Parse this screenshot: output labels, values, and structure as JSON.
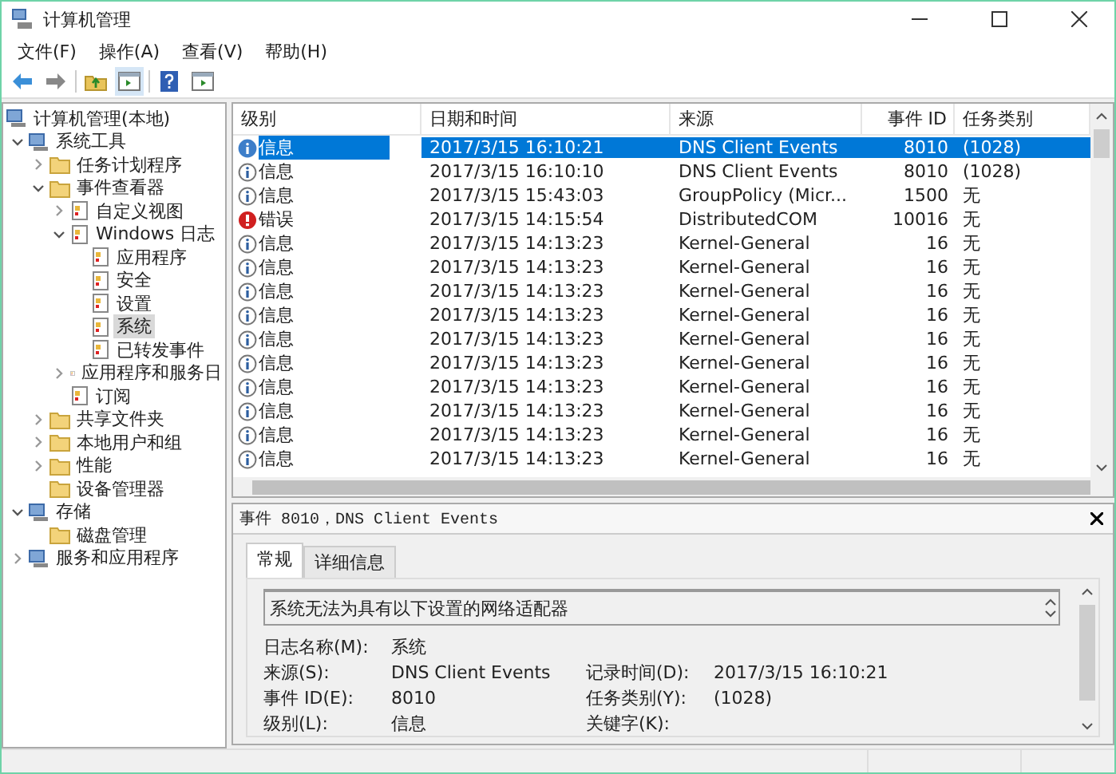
{
  "window": {
    "title": "计算机管理"
  },
  "menu": [
    "文件(F)",
    "操作(A)",
    "查看(V)",
    "帮助(H)"
  ],
  "tree": [
    {
      "label": "计算机管理(本地)",
      "selected": false,
      "children": [
        {
          "label": "系统工具",
          "selected": false,
          "expanded": true,
          "children": [
            {
              "label": "任务计划程序",
              "selected": false,
              "expanded": false
            },
            {
              "label": "事件查看器",
              "selected": false,
              "expanded": true,
              "children": [
                {
                  "label": "自定义视图",
                  "selected": false,
                  "expanded": false
                },
                {
                  "label": "Windows 日志",
                  "selected": false,
                  "expanded": true,
                  "children": [
                    {
                      "label": "应用程序",
                      "selected": false
                    },
                    {
                      "label": "安全",
                      "selected": false
                    },
                    {
                      "label": "设置",
                      "selected": false
                    },
                    {
                      "label": "系统",
                      "selected": true
                    },
                    {
                      "label": "已转发事件",
                      "selected": false
                    }
                  ]
                },
                {
                  "label": "应用程序和服务日",
                  "selected": false,
                  "expanded": false
                },
                {
                  "label": "订阅",
                  "selected": false
                }
              ]
            },
            {
              "label": "共享文件夹",
              "selected": false,
              "expanded": false
            },
            {
              "label": "本地用户和组",
              "selected": false,
              "expanded": false
            },
            {
              "label": "性能",
              "selected": false,
              "expanded": false
            },
            {
              "label": "设备管理器",
              "selected": false
            }
          ]
        },
        {
          "label": "存储",
          "selected": false,
          "expanded": true,
          "children": [
            {
              "label": "磁盘管理",
              "selected": false
            }
          ]
        },
        {
          "label": "服务和应用程序",
          "selected": false,
          "expanded": false
        }
      ]
    }
  ],
  "table": {
    "columns": [
      "级别",
      "日期和时间",
      "来源",
      "事件 ID",
      "任务类别"
    ],
    "rows": [
      {
        "kind": "info",
        "selected": true,
        "cells": [
          "信息",
          "2017/3/15 16:10:21",
          "DNS Client Events",
          "8010",
          "(1028)"
        ]
      },
      {
        "kind": "info",
        "selected": false,
        "cells": [
          "信息",
          "2017/3/15 16:10:10",
          "DNS Client Events",
          "8010",
          "(1028)"
        ]
      },
      {
        "kind": "info",
        "selected": false,
        "cells": [
          "信息",
          "2017/3/15 15:43:03",
          "GroupPolicy (Micr...",
          "1500",
          "无"
        ]
      },
      {
        "kind": "error",
        "selected": false,
        "cells": [
          "错误",
          "2017/3/15 14:15:54",
          "DistributedCOM",
          "10016",
          "无"
        ]
      },
      {
        "kind": "info",
        "selected": false,
        "cells": [
          "信息",
          "2017/3/15 14:13:23",
          "Kernel-General",
          "16",
          "无"
        ]
      },
      {
        "kind": "info",
        "selected": false,
        "cells": [
          "信息",
          "2017/3/15 14:13:23",
          "Kernel-General",
          "16",
          "无"
        ]
      },
      {
        "kind": "info",
        "selected": false,
        "cells": [
          "信息",
          "2017/3/15 14:13:23",
          "Kernel-General",
          "16",
          "无"
        ]
      },
      {
        "kind": "info",
        "selected": false,
        "cells": [
          "信息",
          "2017/3/15 14:13:23",
          "Kernel-General",
          "16",
          "无"
        ]
      },
      {
        "kind": "info",
        "selected": false,
        "cells": [
          "信息",
          "2017/3/15 14:13:23",
          "Kernel-General",
          "16",
          "无"
        ]
      },
      {
        "kind": "info",
        "selected": false,
        "cells": [
          "信息",
          "2017/3/15 14:13:23",
          "Kernel-General",
          "16",
          "无"
        ]
      },
      {
        "kind": "info",
        "selected": false,
        "cells": [
          "信息",
          "2017/3/15 14:13:23",
          "Kernel-General",
          "16",
          "无"
        ]
      },
      {
        "kind": "info",
        "selected": false,
        "cells": [
          "信息",
          "2017/3/15 14:13:23",
          "Kernel-General",
          "16",
          "无"
        ]
      },
      {
        "kind": "info",
        "selected": false,
        "cells": [
          "信息",
          "2017/3/15 14:13:23",
          "Kernel-General",
          "16",
          "无"
        ]
      },
      {
        "kind": "info",
        "selected": false,
        "cells": [
          "信息",
          "2017/3/15 14:13:23",
          "Kernel-General",
          "16",
          "无"
        ]
      }
    ]
  },
  "detail": {
    "title": "事件 8010，DNS Client Events",
    "tabs": [
      {
        "label": "常规",
        "selected": true
      },
      {
        "label": "详细信息",
        "selected": false
      }
    ],
    "message": "系统无法为具有以下设置的网络适配器",
    "fields": [
      [
        {
          "label": "日志名称(M):",
          "value": "系统"
        }
      ],
      [
        {
          "label": "来源(S):",
          "value": "DNS Client Events"
        },
        {
          "label": "记录时间(D):",
          "value": "2017/3/15 16:10:21"
        }
      ],
      [
        {
          "label": "事件 ID(E):",
          "value": "8010"
        },
        {
          "label": "任务类别(Y):",
          "value": "(1028)"
        }
      ],
      [
        {
          "label": "级别(L):",
          "value": "信息"
        },
        {
          "label": "关键字(K):"
        }
      ]
    ]
  }
}
